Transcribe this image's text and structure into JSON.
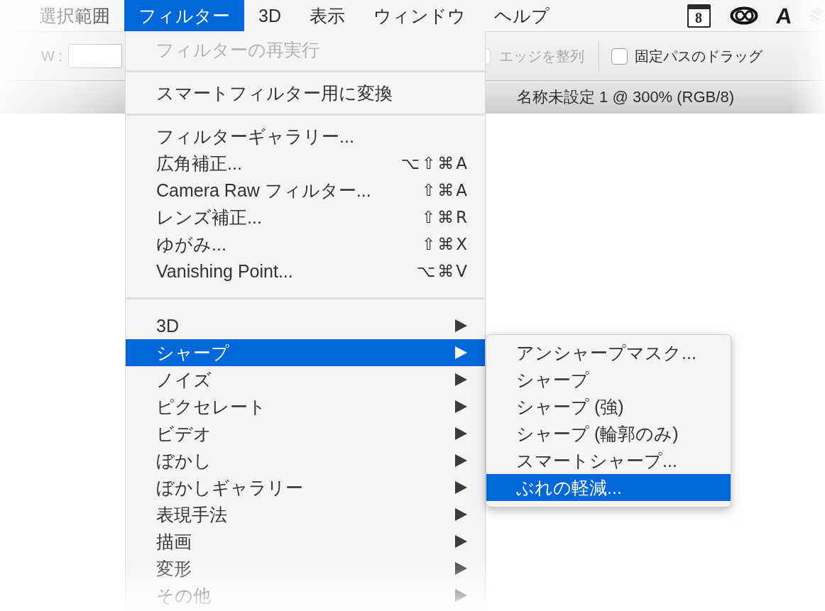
{
  "menu_bar": {
    "items": [
      {
        "label": "選択範囲",
        "selected": false
      },
      {
        "label": "フィルター",
        "selected": true
      },
      {
        "label": "3D",
        "selected": false
      },
      {
        "label": "表示",
        "selected": false
      },
      {
        "label": "ウィンドウ",
        "selected": false
      },
      {
        "label": "ヘルプ",
        "selected": false
      }
    ],
    "status_icons": [
      {
        "kind": "calendar",
        "text": "8"
      },
      {
        "kind": "loop"
      },
      {
        "kind": "letter",
        "text": "A"
      },
      {
        "kind": "layers"
      }
    ]
  },
  "options_bar": {
    "width_label": "W :",
    "checkboxes": [
      {
        "label": "エッジを整列",
        "checked": false,
        "disabled": true
      },
      {
        "label": "固定パスのドラッグ",
        "checked": false,
        "disabled": false
      }
    ]
  },
  "document_tab": {
    "title": "名称未設定 1 @ 300% (RGB/8)"
  },
  "filter_menu": {
    "sections": [
      [
        {
          "label": "フィルターの再実行",
          "kind": "command",
          "selected": false,
          "disabled": true
        }
      ],
      [
        {
          "label": "スマートフィルター用に変換",
          "kind": "command",
          "selected": false,
          "disabled": false
        }
      ],
      [
        {
          "label": "フィルターギャラリー...",
          "kind": "command",
          "selected": false,
          "disabled": false
        },
        {
          "label": "広角補正...",
          "kind": "command",
          "shortcut": "⌥⇧⌘A",
          "selected": false,
          "disabled": false
        },
        {
          "label": "Camera Raw フィルター...",
          "kind": "command",
          "shortcut": "⇧⌘A",
          "selected": false,
          "disabled": false
        },
        {
          "label": "レンズ補正...",
          "kind": "command",
          "shortcut": "⇧⌘R",
          "selected": false,
          "disabled": false
        },
        {
          "label": "ゆがみ...",
          "kind": "command",
          "shortcut": "⇧⌘X",
          "selected": false,
          "disabled": false
        },
        {
          "label": "Vanishing Point...",
          "kind": "command",
          "shortcut": "⌥⌘V",
          "selected": false,
          "disabled": false
        }
      ],
      [
        {
          "label": "3D",
          "kind": "submenu",
          "selected": false,
          "disabled": false
        },
        {
          "label": "シャープ",
          "kind": "submenu",
          "selected": true,
          "disabled": false,
          "submenu": {
            "items": [
              {
                "label": "アンシャープマスク...",
                "selected": false
              },
              {
                "label": "シャープ",
                "selected": false
              },
              {
                "label": "シャープ (強)",
                "selected": false
              },
              {
                "label": "シャープ (輪郭のみ)",
                "selected": false
              },
              {
                "label": "スマートシャープ...",
                "selected": false
              },
              {
                "label": "ぶれの軽減...",
                "selected": true
              }
            ]
          }
        },
        {
          "label": "ノイズ",
          "kind": "submenu",
          "selected": false,
          "disabled": false
        },
        {
          "label": "ピクセレート",
          "kind": "submenu",
          "selected": false,
          "disabled": false
        },
        {
          "label": "ビデオ",
          "kind": "submenu",
          "selected": false,
          "disabled": false
        },
        {
          "label": "ぼかし",
          "kind": "submenu",
          "selected": false,
          "disabled": false
        },
        {
          "label": "ぼかしギャラリー",
          "kind": "submenu",
          "selected": false,
          "disabled": false
        },
        {
          "label": "表現手法",
          "kind": "submenu",
          "selected": false,
          "disabled": false
        },
        {
          "label": "描画",
          "kind": "submenu",
          "selected": false,
          "disabled": false
        },
        {
          "label": "変形",
          "kind": "submenu",
          "selected": false,
          "disabled": false
        },
        {
          "label": "その他",
          "kind": "submenu",
          "selected": false,
          "disabled": false
        }
      ]
    ]
  }
}
